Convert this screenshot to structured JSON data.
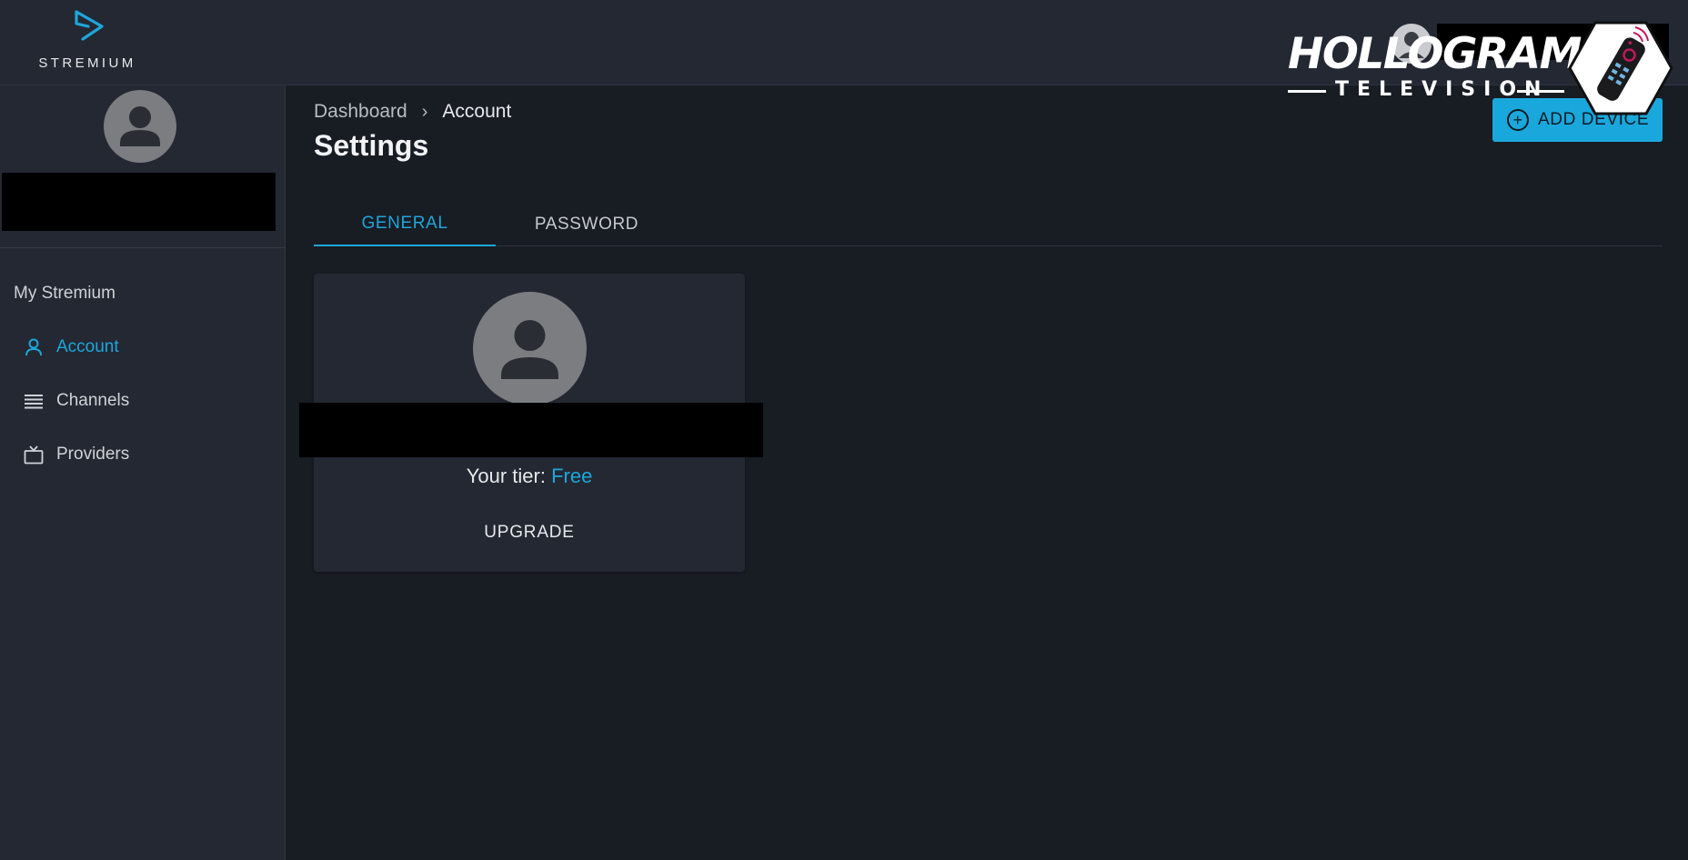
{
  "brand": {
    "name": "STREMIUM"
  },
  "header": {
    "add_device_label": "ADD DEVICE"
  },
  "watermark": {
    "title": "HOLLOGRAM",
    "subtitle": "TELEVISION"
  },
  "sidebar": {
    "section_title": "My Stremium",
    "items": [
      {
        "label": "Account",
        "icon": "person-icon",
        "active": true
      },
      {
        "label": "Channels",
        "icon": "list-icon",
        "active": false
      },
      {
        "label": "Providers",
        "icon": "tv-icon",
        "active": false
      }
    ]
  },
  "breadcrumb": {
    "parent": "Dashboard",
    "separator": "›",
    "current": "Account"
  },
  "page": {
    "title": "Settings"
  },
  "tabs": [
    {
      "label": "GENERAL",
      "active": true
    },
    {
      "label": "PASSWORD",
      "active": false
    }
  ],
  "account_card": {
    "tier_label": "Your tier:",
    "tier_value": "Free",
    "upgrade_label": "UPGRADE"
  },
  "colors": {
    "accent": "#1da7db",
    "background": "#181c23",
    "surface": "#242833",
    "button": "#1aa8dc"
  }
}
